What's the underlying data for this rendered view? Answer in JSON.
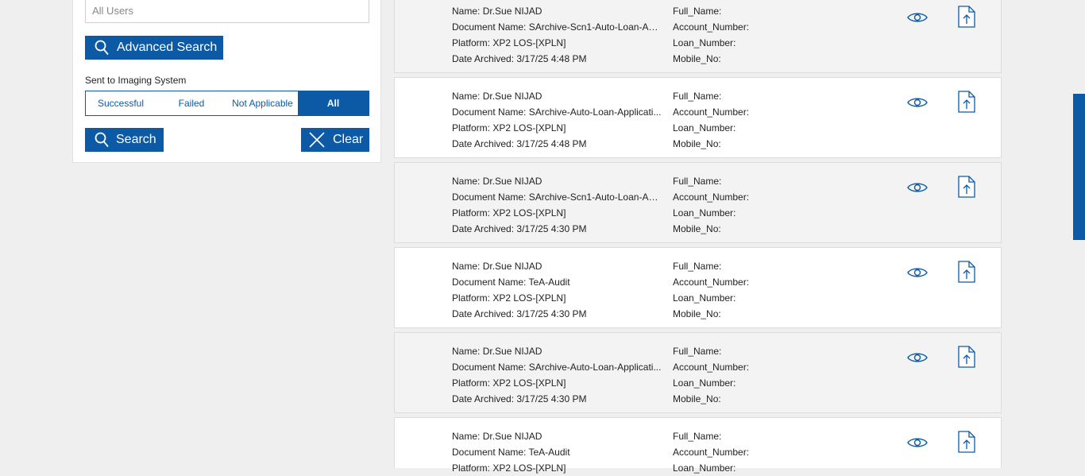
{
  "filters": {
    "user_select_value": "All Users",
    "advanced_search_label": "Advanced Search",
    "imaging_label": "Sent to Imaging System",
    "imaging_options": [
      "Successful",
      "Failed",
      "Not Applicable",
      "All"
    ],
    "imaging_selected": "All",
    "search_label": "Search",
    "clear_label": "Clear"
  },
  "field_labels": {
    "name": "Name:",
    "document_name": "Document Name:",
    "platform": "Platform:",
    "date_archived": "Date Archived:",
    "full_name": "Full_Name:",
    "account_number": "Account_Number:",
    "loan_number": "Loan_Number:",
    "mobile_no": "Mobile_No:"
  },
  "results": [
    {
      "name": "Dr.Sue NIJAD",
      "document_name": "SArchive-Scn1-Auto-Loan-Ap...",
      "platform": "XP2 LOS-[XPLN]",
      "date_archived": "3/17/25 4:48 PM"
    },
    {
      "name": "Dr.Sue NIJAD",
      "document_name": "SArchive-Auto-Loan-Applicati...",
      "platform": "XP2 LOS-[XPLN]",
      "date_archived": "3/17/25 4:48 PM"
    },
    {
      "name": "Dr.Sue NIJAD",
      "document_name": "SArchive-Scn1-Auto-Loan-Ap...",
      "platform": "XP2 LOS-[XPLN]",
      "date_archived": "3/17/25 4:30 PM"
    },
    {
      "name": "Dr.Sue NIJAD",
      "document_name": "TeA-Audit",
      "platform": "XP2 LOS-[XPLN]",
      "date_archived": "3/17/25 4:30 PM"
    },
    {
      "name": "Dr.Sue NIJAD",
      "document_name": "SArchive-Auto-Loan-Applicati...",
      "platform": "XP2 LOS-[XPLN]",
      "date_archived": "3/17/25 4:30 PM"
    },
    {
      "name": "Dr.Sue NIJAD",
      "document_name": "TeA-Audit",
      "platform": "XP2 LOS-[XPLN]",
      "date_archived": ""
    }
  ],
  "icons": {
    "view": "eye-icon",
    "upload": "file-upload-icon",
    "search": "search-icon",
    "clear": "close-icon"
  },
  "colors": {
    "primary": "#0c5aa6",
    "background": "#efefef"
  }
}
